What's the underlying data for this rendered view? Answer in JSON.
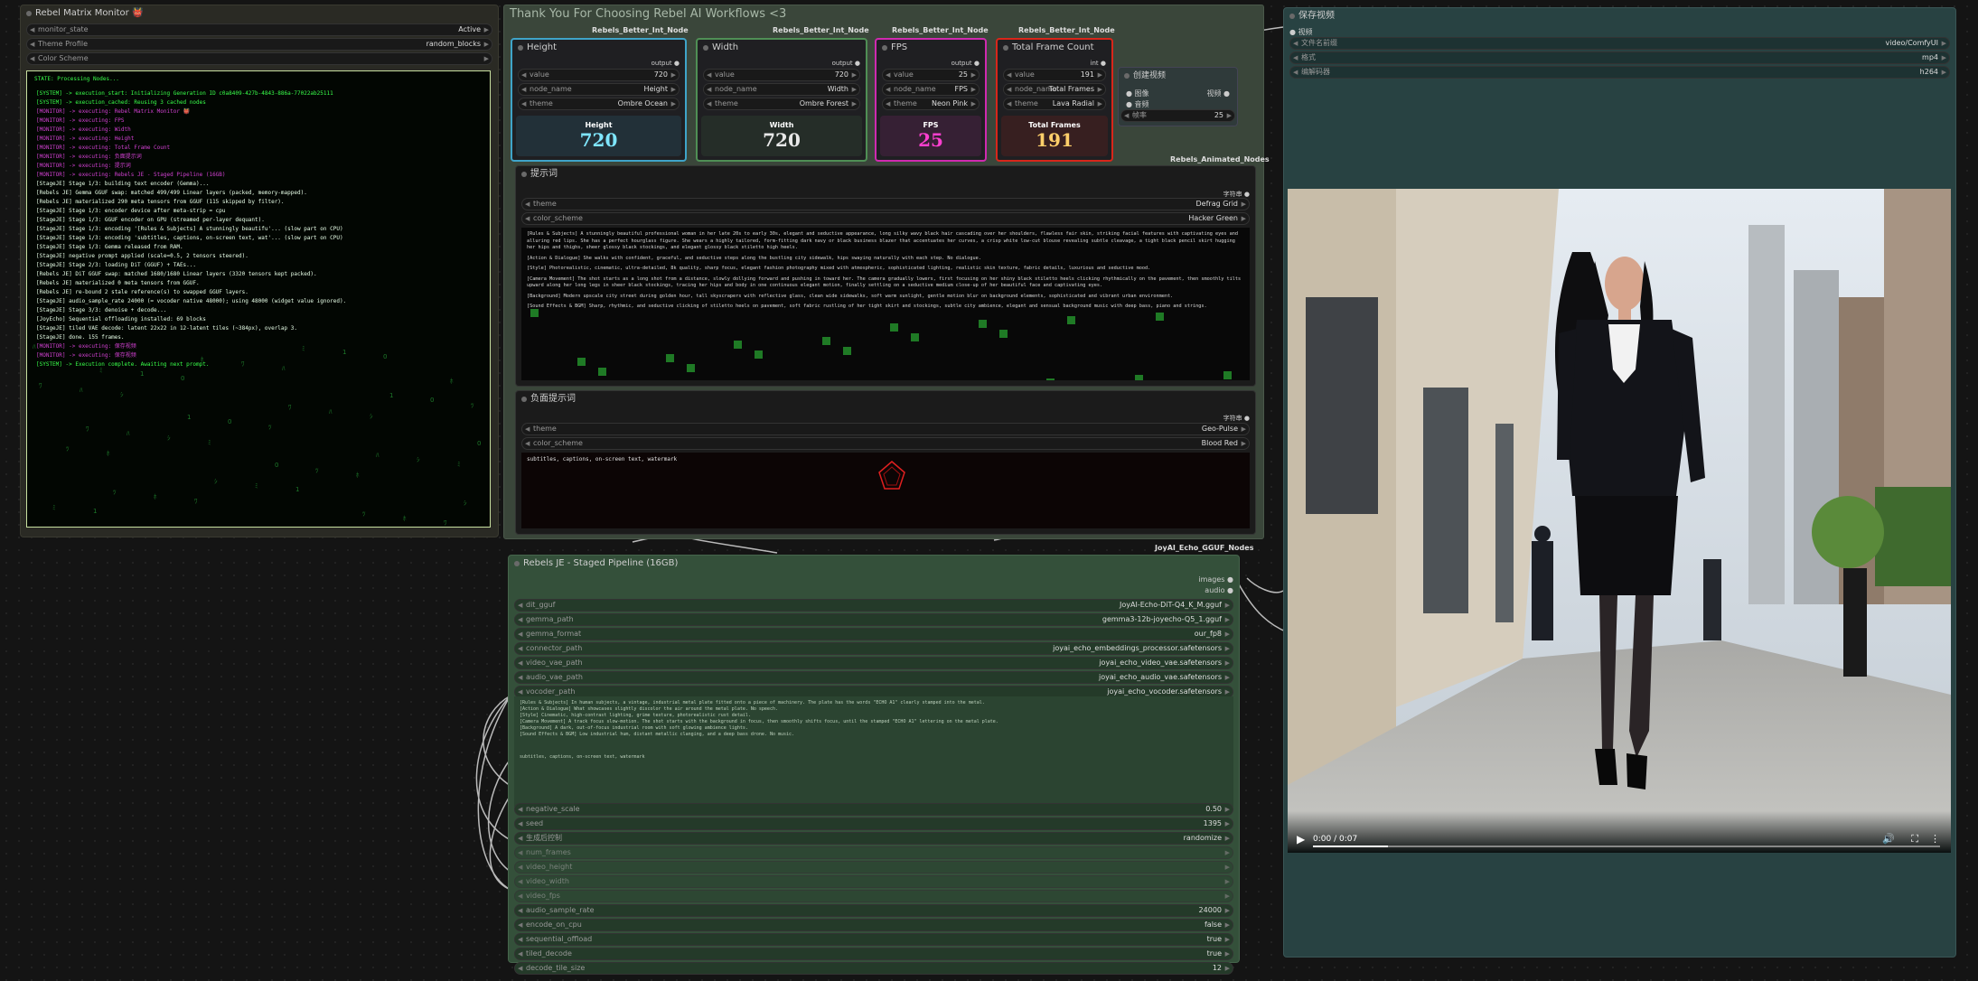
{
  "matrix_monitor": {
    "title": "Rebel Matrix Monitor 👹",
    "rows": [
      {
        "label": "monitor_state",
        "value": "Active"
      },
      {
        "label": "Theme Profile",
        "value": "random_blocks"
      },
      {
        "label": "Color Scheme",
        "value": ""
      }
    ],
    "console_header": "STATE: Processing Nodes...",
    "console_lines": [
      "[SYSTEM] -> execution_start: Initializing Generation ID c0a8409-427b-4843-886a-77022ab25111",
      "[SYSTEM] -> execution_cached: Reusing 3 cached nodes",
      "[MONITOR] -> executing: Rebel Matrix Monitor 👹",
      "[MONITOR] -> executing: FPS",
      "[MONITOR] -> executing: Width",
      "[MONITOR] -> executing: Height",
      "[MONITOR] -> executing: Total Frame Count",
      "[MONITOR] -> executing: 负面提示词",
      "[MONITOR] -> executing: 提示词",
      "[MONITOR] -> executing: Rebels JE - Staged Pipeline (16GB)",
      "[StageJE] Stage 1/3: building text encoder (Gemma)...",
      "[Rebels JE] Gemma GGUF swap: matched 499/499 Linear layers (packed, memory-mapped).",
      "[Rebels JE] materialized 290 meta tensors from GGUF (115 skipped by filter).",
      "[StageJE] Stage 1/3: encoder device after meta-strip = cpu",
      "[StageJE] Stage 1/3: GGUF encoder on GPU (streamed per-layer dequant).",
      "[StageJE] Stage 1/3: encoding '[Rules & Subjects] A stunningly beautifu'... (slow part on CPU)",
      "[StageJE] Stage 1/3: encoding 'subtitles, captions, on-screen text, wat'... (slow part on CPU)",
      "[StageJE] Stage 1/3: Gemma released from RAM.",
      "[StageJE] negative prompt applied (scale=0.5, 2 tensors steered).",
      "[StageJE] Stage 2/3: loading DiT (GGUF) + TAEs...",
      "[Rebels JE] DiT GGUF swap: matched 1680/1680 Linear layers (3320 tensors kept packed).",
      "[Rebels JE] materialized 0 meta tensors from GGUF.",
      "[Rebels JE] re-bound 2 stale reference(s) to swapped GGUF layers.",
      "[StageJE] audio_sample_rate 24000 (= vocoder native 48000); using 48000 (widget value ignored).",
      "[StageJE] Stage 3/3: denoise + decode...",
      "[JoyEcho] Sequential offloading installed: 69 blocks",
      "[StageJE] tiled VAE decode: latent 22x22 in 12-latent tiles (~384px), overlap 3.",
      "[StageJE] done. 155 frames.",
      "[MONITOR] -> executing: 保存视频",
      "[MONITOR] -> executing: 保存视频",
      "[SYSTEM] -> Execution complete. Awaiting next prompt."
    ]
  },
  "group_title": "Thank You For Choosing Rebel AI Workflows <3",
  "int_nodes": [
    {
      "tag": "Rebels_Better_Int_Node",
      "title": "Height",
      "output": "output",
      "value": "720",
      "node_name": "Height",
      "theme": "Ombre Ocean",
      "display_label": "Height",
      "display_value": "720",
      "accent": "#3fa4c9",
      "value_color": "#7fe6ff"
    },
    {
      "tag": "Rebels_Better_Int_Node",
      "title": "Width",
      "output": "output",
      "value": "720",
      "node_name": "Width",
      "theme": "Ombre Forest",
      "display_label": "Width",
      "display_value": "720",
      "accent": "#4f8f55",
      "value_color": "#e8e8e8"
    },
    {
      "tag": "Rebels_Better_Int_Node",
      "title": "FPS",
      "output": "output",
      "value": "25",
      "node_name": "FPS",
      "theme": "Neon Pink",
      "display_label": "FPS",
      "display_value": "25",
      "accent": "#d02ab0",
      "value_color": "#ff3fd0"
    },
    {
      "tag": "Rebels_Better_Int_Node",
      "title": "Total Frame Count",
      "output": "int",
      "output2": "string",
      "value": "191",
      "node_name": "Total Frames",
      "theme": "Lava Radial",
      "display_label": "Total Frames",
      "display_value": "191",
      "accent": "#d8261a",
      "value_color": "#ffcf6a"
    }
  ],
  "create_video": {
    "title": "创建视频",
    "in1": "图像",
    "in2": "音频",
    "out": "视频",
    "fps_label": "帧率",
    "fps_value": "25"
  },
  "animated_tag": "Rebels_Animated_Nodes",
  "prompt_node": {
    "title": "提示词",
    "out": "字符串",
    "theme_label": "theme",
    "theme_value": "Defrag Grid",
    "scheme_label": "color_scheme",
    "scheme_value": "Hacker Green",
    "paragraphs": [
      "[Rules & Subjects] A stunningly beautiful professional woman in her late 20s to early 30s, elegant and seductive appearance, long silky wavy black hair cascading over her shoulders, flawless fair skin, striking facial features with captivating eyes and alluring red lips. She has a perfect hourglass figure. She wears a highly tailored, form-fitting dark navy or black business blazer that accentuates her curves, a crisp white low-cut blouse revealing subtle cleavage, a tight black pencil skirt hugging her hips and thighs, sheer glossy black stockings, and elegant glossy black stiletto high heels.",
      "[Action & Dialogue] She walks with confident, graceful, and seductive steps along the bustling city sidewalk, hips swaying naturally with each step. No dialogue.",
      "[Style] Photorealistic, cinematic, ultra-detailed, 8k quality, sharp focus, elegant fashion photography mixed with atmospheric, sophisticated lighting, realistic skin texture, fabric details, luxurious and seductive mood.",
      "[Camera Movement] The shot starts as a long shot from a distance, slowly dollying forward and pushing in toward her. The camera gradually lowers, first focusing on her shiny black stiletto heels clicking rhythmically on the pavement, then smoothly tilts upward along her long legs in sheer black stockings, tracing her hips and body in one continuous elegant motion, finally settling on a seductive medium close-up of her beautiful face and captivating eyes.",
      "[Background] Modern upscale city street during golden hour, tall skyscrapers with reflective glass, clean wide sidewalks, soft warm sunlight, gentle motion blur on background elements, sophisticated and vibrant urban environment.",
      "[Sound Effects & BGM] Sharp, rhythmic, and seductive clicking of stiletto heels on pavement, soft fabric rustling of her tight skirt and stockings, subtle city ambience, elegant and sensual background music with deep bass, piano and strings."
    ]
  },
  "neg_node": {
    "title": "负面提示词",
    "out": "字符串",
    "theme_label": "theme",
    "theme_value": "Geo-Pulse",
    "scheme_label": "color_scheme",
    "scheme_value": "Blood Red",
    "text": "subtitles, captions, on-screen text, watermark"
  },
  "pipeline": {
    "tag": "JoyAI_Echo_GGUF_Nodes",
    "title": "Rebels JE - Staged Pipeline (16GB)",
    "out1": "images",
    "out2": "audio",
    "rows": [
      {
        "label": "dit_gguf",
        "value": "JoyAI-Echo-DiT-Q4_K_M.gguf"
      },
      {
        "label": "gemma_path",
        "value": "gemma3-12b-joyecho-Q5_1.gguf"
      },
      {
        "label": "gemma_format",
        "value": "our_fp8"
      },
      {
        "label": "connector_path",
        "value": "joyai_echo_embeddings_processor.safetensors"
      },
      {
        "label": "video_vae_path",
        "value": "joyai_echo_video_vae.safetensors"
      },
      {
        "label": "audio_vae_path",
        "value": "joyai_echo_audio_vae.safetensors"
      },
      {
        "label": "vocoder_path",
        "value": "joyai_echo_vocoder.safetensors"
      }
    ],
    "prompt_preview": [
      "[Rules & Subjects] In human subjects, a vintage, industrial metal plate fitted onto a piece of machinery. The plate has the words \"ECHO A1\" clearly stamped into the metal.",
      "[Action & Dialogue] What showcases slightly discolor the air around the metal plate. No speech.",
      "[Style] Cinematic, high-contrast lighting, grime texture, photorealistic rust detail.",
      "[Camera Movement] A track focus slow-motion. The shot starts with the background in focus, then smoothly shifts focus, until the stamped \"ECHO A1\" lettering on the metal plate.",
      "[Background] A dark, out-of-focus industrial room with soft glowing ambience lights.",
      "[Sound Effects & BGM] Low industrial hum, distant metallic clanging, and a deep bass drone. No music."
    ],
    "neg_preview": "subtitles, captions, on-screen text, watermark",
    "rows2": [
      {
        "label": "negative_scale",
        "value": "0.50"
      },
      {
        "label": "seed",
        "value": "1395"
      },
      {
        "label": "生成后控制",
        "value": "randomize"
      }
    ],
    "inputs": [
      "num_frames",
      "video_height",
      "video_width",
      "video_fps"
    ],
    "rows3": [
      {
        "label": "audio_sample_rate",
        "value": "24000"
      },
      {
        "label": "encode_on_cpu",
        "value": "false"
      },
      {
        "label": "sequential_offload",
        "value": "true"
      },
      {
        "label": "tiled_decode",
        "value": "true"
      },
      {
        "label": "decode_tile_size",
        "value": "12"
      }
    ]
  },
  "save_video": {
    "title": "保存视频",
    "in_label": "视频",
    "rows": [
      {
        "label": "文件名前缀",
        "value": "video/ComfyUI"
      },
      {
        "label": "格式",
        "value": "mp4"
      },
      {
        "label": "编解码器",
        "value": "h264"
      }
    ],
    "time": "0:00 / 0:07"
  },
  "colors": {
    "hacker_green": "#39ff4a",
    "blood_red": "#e02020",
    "group_bg": "#3c4a3c",
    "save_bg": "#2a4343",
    "pipeline_bg": "#35503a"
  }
}
